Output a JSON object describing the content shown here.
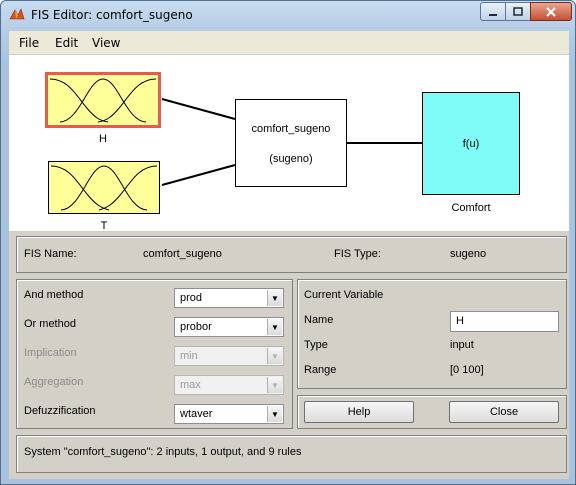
{
  "window": {
    "title": "FIS Editor: comfort_sugeno"
  },
  "menu": [
    "File",
    "Edit",
    "View"
  ],
  "diagram": {
    "inputs": [
      {
        "name": "H",
        "selected": true
      },
      {
        "name": "T",
        "selected": false
      }
    ],
    "system": {
      "name": "comfort_sugeno",
      "type": "(sugeno)"
    },
    "output": {
      "func": "f(u)",
      "name": "Comfort"
    }
  },
  "fis_info": {
    "name_label": "FIS Name:",
    "name_value": "comfort_sugeno",
    "type_label": "FIS Type:",
    "type_value": "sugeno"
  },
  "methods": {
    "and": {
      "label": "And method",
      "value": "prod"
    },
    "or": {
      "label": "Or method",
      "value": "probor"
    },
    "implication": {
      "label": "Implication",
      "value": "min"
    },
    "aggregation": {
      "label": "Aggregation",
      "value": "max"
    },
    "defuzz": {
      "label": "Defuzzification",
      "value": "wtaver"
    }
  },
  "current_variable": {
    "title": "Current Variable",
    "name_label": "Name",
    "name_value": "H",
    "type_label": "Type",
    "type_value": "input",
    "range_label": "Range",
    "range_value": "[0 100]"
  },
  "buttons": {
    "help": "Help",
    "close": "Close"
  },
  "status": "System \"comfort_sugeno\": 2 inputs, 1 output, and 9 rules",
  "colors": {
    "input_fill": "#ffff99",
    "output_fill": "#7ffcf7",
    "selected_border": "#e85a4a"
  }
}
